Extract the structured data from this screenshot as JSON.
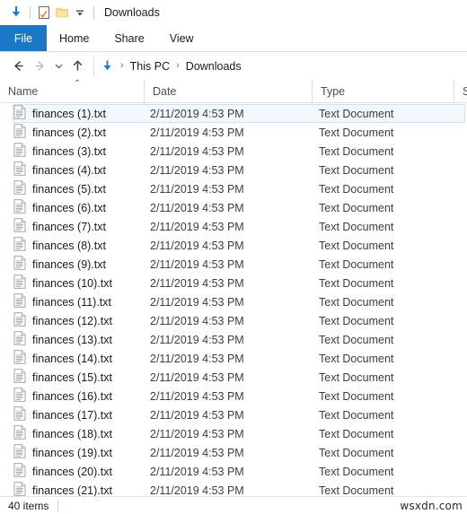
{
  "window": {
    "title": "Downloads",
    "quick_access": [
      {
        "name": "downloads-arrow-icon",
        "label": "Downloads"
      },
      {
        "name": "properties-icon",
        "label": "Properties"
      },
      {
        "name": "new-folder-icon",
        "label": "New folder"
      },
      {
        "name": "customize-chevron-icon",
        "label": "Customize Quick Access Toolbar"
      }
    ]
  },
  "ribbon": {
    "tabs": [
      {
        "label": "File",
        "active": true
      },
      {
        "label": "Home",
        "active": false
      },
      {
        "label": "Share",
        "active": false
      },
      {
        "label": "View",
        "active": false
      }
    ]
  },
  "nav": {
    "back_label": "Back",
    "forward_label": "Forward",
    "recent_label": "Recent locations",
    "up_label": "Up",
    "breadcrumb": [
      "This PC",
      "Downloads"
    ],
    "separator": "›"
  },
  "columns": [
    {
      "label": "Name",
      "sorted": true,
      "sort_glyph": "⌃"
    },
    {
      "label": "Date",
      "sorted": false
    },
    {
      "label": "Type",
      "sorted": false
    },
    {
      "label": "Si",
      "sorted": false
    }
  ],
  "files": [
    {
      "name": "finances (1).txt",
      "date": "2/11/2019 4:53 PM",
      "type": "Text Document",
      "hover": true
    },
    {
      "name": "finances (2).txt",
      "date": "2/11/2019 4:53 PM",
      "type": "Text Document",
      "hover": false
    },
    {
      "name": "finances (3).txt",
      "date": "2/11/2019 4:53 PM",
      "type": "Text Document",
      "hover": false
    },
    {
      "name": "finances (4).txt",
      "date": "2/11/2019 4:53 PM",
      "type": "Text Document",
      "hover": false
    },
    {
      "name": "finances (5).txt",
      "date": "2/11/2019 4:53 PM",
      "type": "Text Document",
      "hover": false
    },
    {
      "name": "finances (6).txt",
      "date": "2/11/2019 4:53 PM",
      "type": "Text Document",
      "hover": false
    },
    {
      "name": "finances (7).txt",
      "date": "2/11/2019 4:53 PM",
      "type": "Text Document",
      "hover": false
    },
    {
      "name": "finances (8).txt",
      "date": "2/11/2019 4:53 PM",
      "type": "Text Document",
      "hover": false
    },
    {
      "name": "finances (9).txt",
      "date": "2/11/2019 4:53 PM",
      "type": "Text Document",
      "hover": false
    },
    {
      "name": "finances (10).txt",
      "date": "2/11/2019 4:53 PM",
      "type": "Text Document",
      "hover": false
    },
    {
      "name": "finances (11).txt",
      "date": "2/11/2019 4:53 PM",
      "type": "Text Document",
      "hover": false
    },
    {
      "name": "finances (12).txt",
      "date": "2/11/2019 4:53 PM",
      "type": "Text Document",
      "hover": false
    },
    {
      "name": "finances (13).txt",
      "date": "2/11/2019 4:53 PM",
      "type": "Text Document",
      "hover": false
    },
    {
      "name": "finances (14).txt",
      "date": "2/11/2019 4:53 PM",
      "type": "Text Document",
      "hover": false
    },
    {
      "name": "finances (15).txt",
      "date": "2/11/2019 4:53 PM",
      "type": "Text Document",
      "hover": false
    },
    {
      "name": "finances (16).txt",
      "date": "2/11/2019 4:53 PM",
      "type": "Text Document",
      "hover": false
    },
    {
      "name": "finances (17).txt",
      "date": "2/11/2019 4:53 PM",
      "type": "Text Document",
      "hover": false
    },
    {
      "name": "finances (18).txt",
      "date": "2/11/2019 4:53 PM",
      "type": "Text Document",
      "hover": false
    },
    {
      "name": "finances (19).txt",
      "date": "2/11/2019 4:53 PM",
      "type": "Text Document",
      "hover": false
    },
    {
      "name": "finances (20).txt",
      "date": "2/11/2019 4:53 PM",
      "type": "Text Document",
      "hover": false
    },
    {
      "name": "finances (21).txt",
      "date": "2/11/2019 4:53 PM",
      "type": "Text Document",
      "hover": false
    }
  ],
  "status": {
    "item_count": "40 items"
  },
  "watermark": "wsxdn.com",
  "colors": {
    "accent": "#1a77c6",
    "hover_fill": "#f2f8fd",
    "hover_border": "#cde3f5",
    "folder_yellow": "#fbdf8a",
    "text": "#1b1b1b"
  }
}
